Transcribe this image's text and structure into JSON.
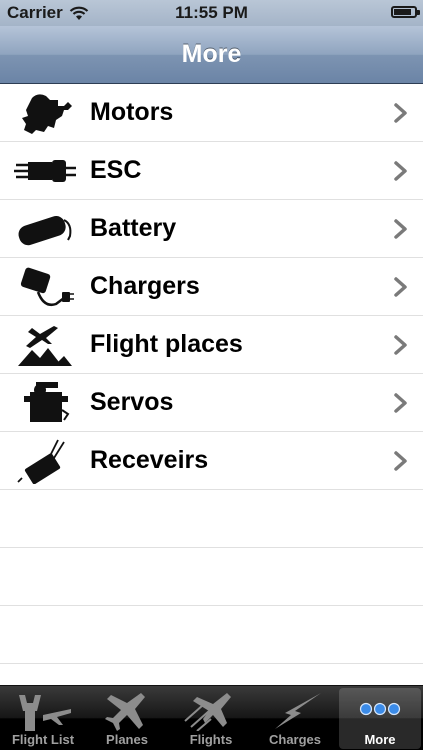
{
  "status_bar": {
    "carrier": "Carrier",
    "time": "11:55 PM"
  },
  "nav": {
    "title": "More"
  },
  "list": {
    "items": [
      {
        "label": "Motors",
        "icon": "motor-icon"
      },
      {
        "label": "ESC",
        "icon": "esc-icon"
      },
      {
        "label": "Battery",
        "icon": "battery-icon"
      },
      {
        "label": "Chargers",
        "icon": "charger-icon"
      },
      {
        "label": "Flight places",
        "icon": "flight-places-icon"
      },
      {
        "label": "Servos",
        "icon": "servo-icon"
      },
      {
        "label": "Receveirs",
        "icon": "receiver-icon"
      }
    ]
  },
  "tab_bar": {
    "tabs": [
      {
        "label": "Flight List",
        "icon": "flight-list-icon"
      },
      {
        "label": "Planes",
        "icon": "plane-icon"
      },
      {
        "label": "Flights",
        "icon": "flights-icon"
      },
      {
        "label": "Charges",
        "icon": "lightning-icon"
      },
      {
        "label": "More",
        "icon": "more-dots-icon",
        "selected": true
      }
    ]
  },
  "colors": {
    "nav_bar": "#7d94b2",
    "tab_bar": "#000000",
    "more_dots": "#3b8be8"
  }
}
